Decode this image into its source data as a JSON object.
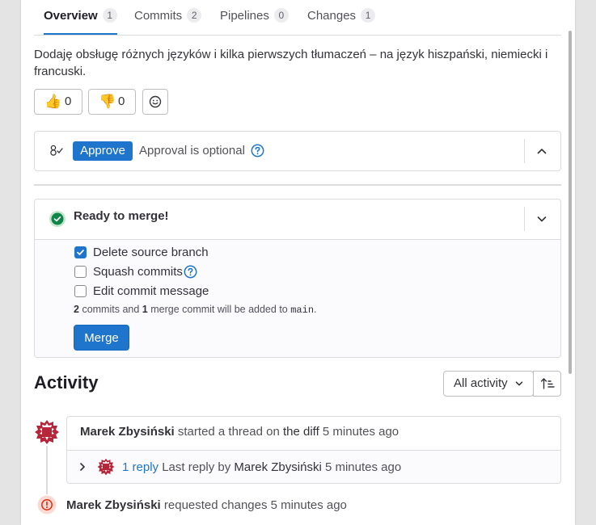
{
  "tabs": [
    {
      "label": "Overview",
      "count": "1"
    },
    {
      "label": "Commits",
      "count": "2"
    },
    {
      "label": "Pipelines",
      "count": "0"
    },
    {
      "label": "Changes",
      "count": "1"
    }
  ],
  "description": "Dodaję obsługę różnych języków i kilka pierwszych tłumaczeń – na język hiszpański, niemiecki i francuski.",
  "reactions": {
    "thumbs_up_emoji": "👍",
    "thumbs_up_count": "0",
    "thumbs_down_emoji": "👎",
    "thumbs_down_count": "0"
  },
  "approval": {
    "approve_label": "Approve",
    "optional_text": "Approval is optional"
  },
  "merge": {
    "status": "Ready to merge!",
    "options": [
      {
        "label": "Delete source branch",
        "checked": true
      },
      {
        "label": "Squash commits",
        "checked": false
      },
      {
        "label": "Edit commit message",
        "checked": false
      }
    ],
    "commit_count": "2",
    "commit_text": "commits and",
    "merge_commit_count": "1",
    "merge_commit_text": "merge commit will be added to",
    "target_branch": "main",
    "period": ".",
    "merge_label": "Merge"
  },
  "activity": {
    "heading": "Activity",
    "filter_label": "All activity",
    "thread": {
      "author": "Marek Zbysiński",
      "action": "started a thread on",
      "target": "the diff",
      "time": "5 minutes ago",
      "reply_count": "1 reply",
      "last_reply_prefix": "Last reply by",
      "last_reply_author": "Marek Zbysiński",
      "last_reply_time": "5 minutes ago"
    },
    "event": {
      "author": "Marek Zbysiński",
      "action": "requested changes",
      "time": "5 minutes ago"
    }
  },
  "colors": {
    "accent": "#1f75cb",
    "success": "#108548",
    "danger": "#dd2b0e",
    "avatar": "#b5263b"
  }
}
